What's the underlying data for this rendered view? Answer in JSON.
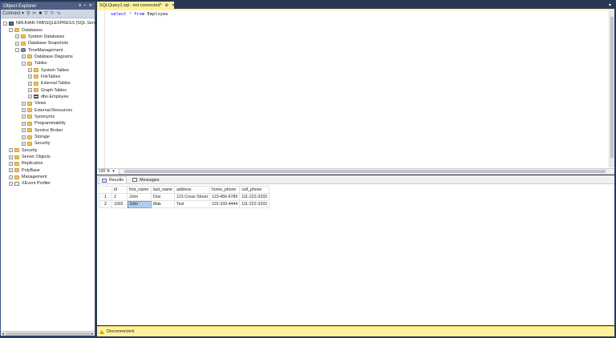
{
  "object_explorer": {
    "title": "Object Explorer",
    "title_buttons": [
      "▾",
      "▪",
      "✕"
    ],
    "toolbar": {
      "connect_label": "Connect ▾",
      "icons": [
        "connect-icon",
        "disconnect-icon",
        "stop-icon",
        "filter-icon",
        "refresh-icon",
        "activity-icon"
      ]
    },
    "tree": [
      {
        "label": "NIRJHAR-TAB\\SQLEXPRESS (SQL Serve",
        "level": 0,
        "expander": "-",
        "icon": "server"
      },
      {
        "label": "Databases",
        "level": 1,
        "expander": "-",
        "icon": "folder"
      },
      {
        "label": "System Databases",
        "level": 2,
        "expander": "+",
        "icon": "folder"
      },
      {
        "label": "Database Snapshots",
        "level": 2,
        "expander": "+",
        "icon": "folder"
      },
      {
        "label": "TimeManagement",
        "level": 2,
        "expander": "-",
        "icon": "db"
      },
      {
        "label": "Database Diagrams",
        "level": 3,
        "expander": "+",
        "icon": "folder"
      },
      {
        "label": "Tables",
        "level": 3,
        "expander": "-",
        "icon": "folder"
      },
      {
        "label": "System Tables",
        "level": 4,
        "expander": "+",
        "icon": "folder"
      },
      {
        "label": "FileTables",
        "level": 4,
        "expander": "+",
        "icon": "folder"
      },
      {
        "label": "External Tables",
        "level": 4,
        "expander": "+",
        "icon": "folder"
      },
      {
        "label": "Graph Tables",
        "level": 4,
        "expander": "+",
        "icon": "folder"
      },
      {
        "label": "dbo.Employee",
        "level": 4,
        "expander": "+",
        "icon": "table"
      },
      {
        "label": "Views",
        "level": 3,
        "expander": "+",
        "icon": "folder"
      },
      {
        "label": "External Resources",
        "level": 3,
        "expander": "+",
        "icon": "folder"
      },
      {
        "label": "Synonyms",
        "level": 3,
        "expander": "+",
        "icon": "folder"
      },
      {
        "label": "Programmability",
        "level": 3,
        "expander": "+",
        "icon": "folder"
      },
      {
        "label": "Service Broker",
        "level": 3,
        "expander": "+",
        "icon": "folder"
      },
      {
        "label": "Storage",
        "level": 3,
        "expander": "+",
        "icon": "folder"
      },
      {
        "label": "Security",
        "level": 3,
        "expander": "+",
        "icon": "folder"
      },
      {
        "label": "Security",
        "level": 1,
        "expander": "+",
        "icon": "folder"
      },
      {
        "label": "Server Objects",
        "level": 1,
        "expander": "+",
        "icon": "folder"
      },
      {
        "label": "Replication",
        "level": 1,
        "expander": "+",
        "icon": "folder"
      },
      {
        "label": "PolyBase",
        "level": 1,
        "expander": "+",
        "icon": "folder"
      },
      {
        "label": "Management",
        "level": 1,
        "expander": "+",
        "icon": "folder"
      },
      {
        "label": "XEvent Profiler",
        "level": 1,
        "expander": "+",
        "icon": "node"
      }
    ]
  },
  "editor": {
    "tab_title": "SQLQuery1.sql - not connected*",
    "tab_pin": "⊕",
    "tab_close": "✕",
    "tabstrip_dropdown": "▾",
    "code": {
      "kw1": "select",
      "op": "*",
      "kw2": "from",
      "ident": "Employee"
    },
    "zoom": "100 %",
    "zoom_arrow": "▾"
  },
  "results": {
    "tabs": [
      {
        "label": "Results",
        "active": true
      },
      {
        "label": "Messages",
        "active": false
      }
    ],
    "columns": [
      "id",
      "first_name",
      "last_name",
      "address",
      "home_phone",
      "cell_phone"
    ],
    "rows": [
      [
        "2",
        "John",
        "Doe",
        "123 Cross Street",
        "123-456-6789",
        "111-222-3333"
      ],
      [
        "1002",
        "John",
        "Mak",
        "Test",
        "222-333-4444",
        "111-222-3333"
      ]
    ],
    "row_numbers": [
      "1",
      "2"
    ]
  },
  "status": {
    "text": "Disconnected."
  },
  "colors": {
    "shell": "#293955",
    "tab_active": "#fff29d",
    "status_bar": "#fff29d",
    "keyword": "#0000ff"
  }
}
